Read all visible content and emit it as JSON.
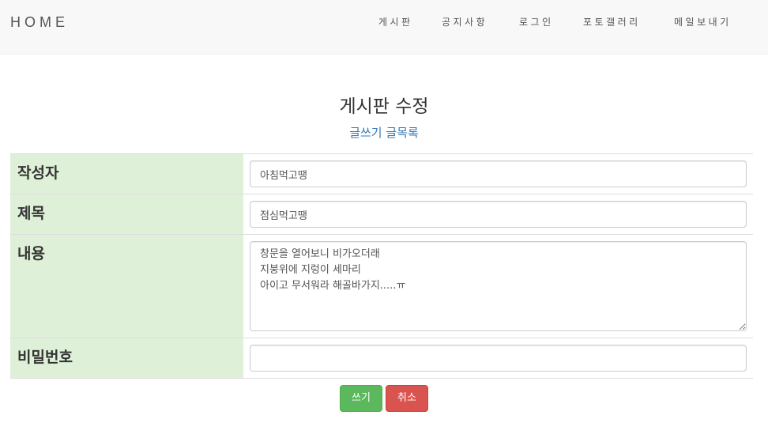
{
  "navbar": {
    "brand": "HOME",
    "items": [
      "게시판",
      "공지사항",
      "로그인",
      "포토갤러리",
      "메일보내기"
    ]
  },
  "page_title": "게시판 수정",
  "links": {
    "write": "글쓰기",
    "list": "글목록"
  },
  "form": {
    "writer_label": "작성자",
    "writer_value": "아침먹고땡",
    "subject_label": "제목",
    "subject_value": "점심먹고땡",
    "content_label": "내용",
    "content_value": "창문을 열어보니 비가오더래\n지붕위에 지렁이 세마리\n아이고 무서워라 해골바가지.....ㅠ",
    "password_label": "비밀번호",
    "password_value": ""
  },
  "buttons": {
    "submit": "쓰기",
    "cancel": "취소"
  },
  "colors": {
    "label_bg": "#dff0d8",
    "link": "#337ab7",
    "success": "#5cb85c",
    "danger": "#d9534f"
  }
}
